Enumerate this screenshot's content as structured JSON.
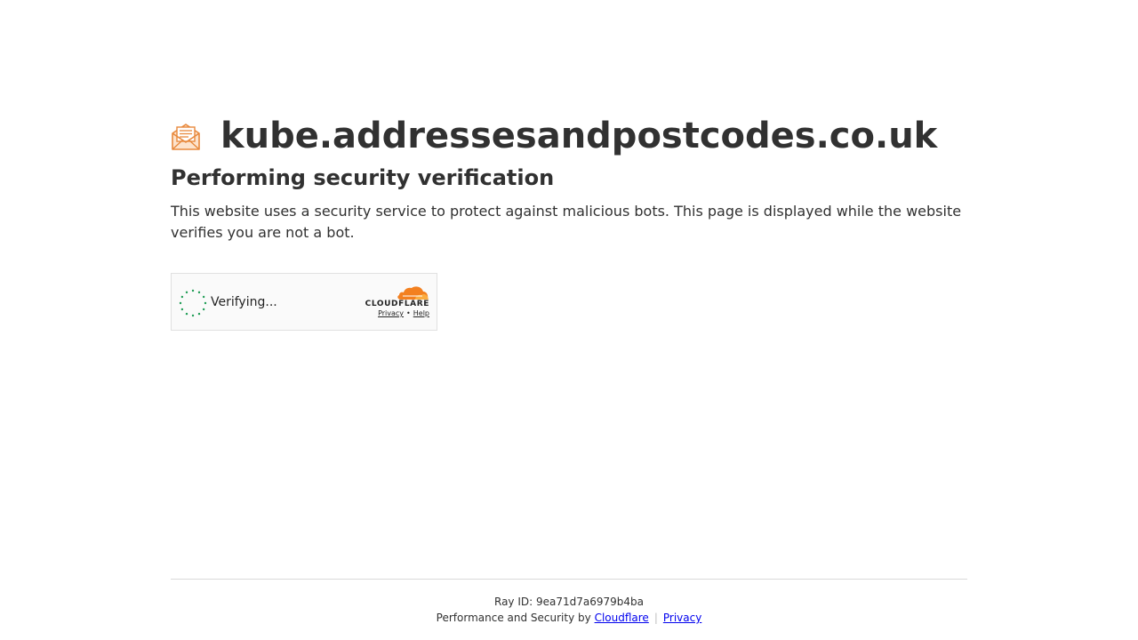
{
  "header": {
    "site_name": "kube.addressesandpostcodes.co.uk",
    "site_icon": "envelope-letter-icon"
  },
  "main": {
    "heading": "Performing security verification",
    "description": "This website uses a security service to protect against malicious bots. This page is displayed while the website verifies you are not a bot."
  },
  "widget": {
    "status": "Verifying...",
    "brand": "CLOUDFLARE",
    "privacy_link": "Privacy",
    "separator": "•",
    "help_link": "Help",
    "spinner_color": "#1f9d55",
    "brand_color": "#f38020"
  },
  "footer": {
    "ray_id": "Ray ID: 9ea71d7a6979b4ba",
    "perf_text": "Performance and Security by",
    "cloudflare_link": "Cloudflare",
    "separator": "|",
    "privacy_link": "Privacy"
  }
}
